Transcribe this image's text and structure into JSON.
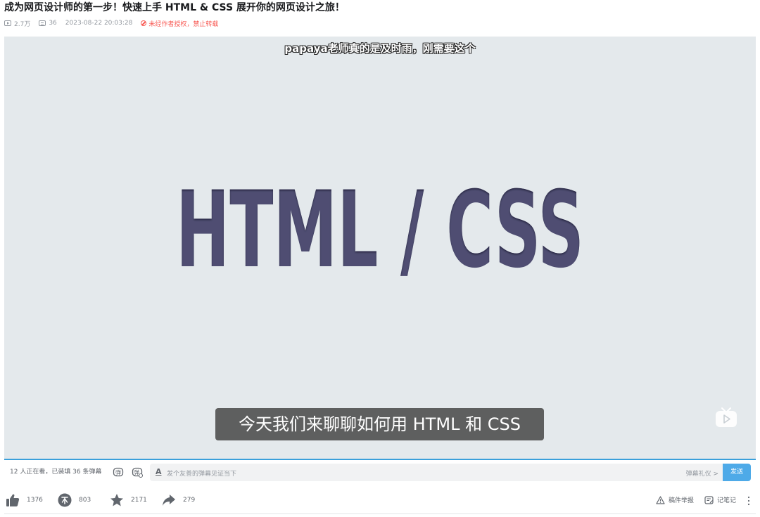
{
  "video": {
    "title": "成为网页设计师的第一步！快速上手 HTML & CSS 展开你的网页设计之旅！",
    "views": "2.7万",
    "danmaku_count": "36",
    "datetime": "2023-08-22 20:03:28",
    "copyright_notice": "未经作者授权，禁止转载"
  },
  "player": {
    "top_danmaku": "papaya老师真的是及时雨，刚需要这个",
    "main_text": "HTML / CSS",
    "subtitle": "今天我们来聊聊如何用 HTML 和 CSS",
    "progress_percent": 0
  },
  "danmaku_bar": {
    "status": "12 人正在看，已装填 36 条弹幕",
    "input_placeholder": "发个友善的弹幕见证当下",
    "etiquette": "弹幕礼仪 >",
    "send": "发送"
  },
  "actions": {
    "like": "1376",
    "coin": "803",
    "favorite": "2171",
    "share": "279",
    "report": "稿件举报",
    "notes": "记笔记"
  },
  "colors": {
    "accent": "#4eaae8",
    "warning": "#f85a54",
    "title_text": "#4f4e72",
    "player_bg": "#e4e9ec"
  }
}
